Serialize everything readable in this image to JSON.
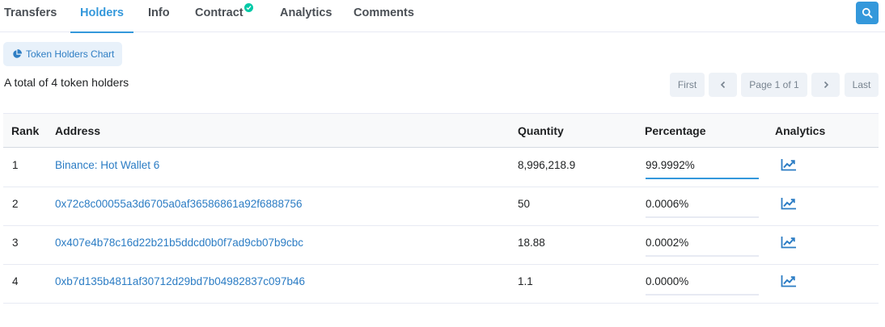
{
  "tabs": [
    {
      "label": "Transfers",
      "active": false
    },
    {
      "label": "Holders",
      "active": true
    },
    {
      "label": "Info",
      "active": false
    },
    {
      "label": "Contract",
      "active": false,
      "verified": true
    },
    {
      "label": "Analytics",
      "active": false
    },
    {
      "label": "Comments",
      "active": false
    }
  ],
  "search_icon": "search-icon",
  "chart_button": {
    "icon": "pie-chart-icon",
    "label": "Token Holders Chart"
  },
  "summary": "A total of 4 token holders",
  "pagination": {
    "first": "First",
    "prev_icon": "chevron-left-icon",
    "page_text": "Page 1 of 1",
    "next_icon": "chevron-right-icon",
    "last": "Last"
  },
  "table": {
    "headers": {
      "rank": "Rank",
      "address": "Address",
      "quantity": "Quantity",
      "percentage": "Percentage",
      "analytics": "Analytics"
    },
    "rows": [
      {
        "rank": "1",
        "address": "Binance: Hot Wallet 6",
        "quantity": "8,996,218.9",
        "percentage": "99.9992%",
        "share": 0.999992,
        "analytics_icon": "line-chart-icon"
      },
      {
        "rank": "2",
        "address": "0x72c8c00055a3d6705a0af36586861a92f6888756",
        "quantity": "50",
        "percentage": "0.0006%",
        "share": 6e-06,
        "analytics_icon": "line-chart-icon"
      },
      {
        "rank": "3",
        "address": "0x407e4b78c16d22b21b5ddcd0b0f7ad9cb07b9cbc",
        "quantity": "18.88",
        "percentage": "0.0002%",
        "share": 2e-06,
        "analytics_icon": "line-chart-icon"
      },
      {
        "rank": "4",
        "address": "0xb7d135b4811af30712d29bd7b04982837c097b46",
        "quantity": "1.1",
        "percentage": "0.0000%",
        "share": 0.0,
        "analytics_icon": "line-chart-icon"
      }
    ]
  },
  "colors": {
    "accent": "#3498db",
    "verified": "#00c9a7",
    "link": "#2b7cc4"
  }
}
